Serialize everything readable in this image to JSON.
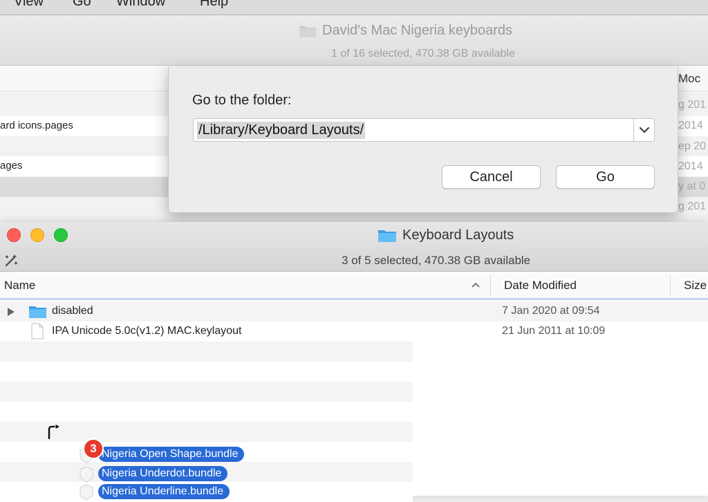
{
  "menubar": {
    "items": [
      "View",
      "Go",
      "Window",
      "Help"
    ]
  },
  "background_window": {
    "title": "David's Mac Nigeria keyboards",
    "status": "1 of 16 selected, 470.38 GB available",
    "column_right_header": "Moc",
    "rows": [
      "ard icons.pages",
      "ages"
    ],
    "right_column_values": [
      "g 201",
      "2014",
      "ep 20",
      "2014",
      "y at 0",
      "g 201"
    ]
  },
  "goto_sheet": {
    "label": "Go to the folder:",
    "path_value": "/Library/Keyboard Layouts/",
    "cancel_label": "Cancel",
    "go_label": "Go"
  },
  "front_window": {
    "title": "Keyboard Layouts",
    "status": "3 of 5 selected, 470.38 GB available",
    "columns": {
      "name": "Name",
      "date_modified": "Date Modified",
      "size": "Size"
    },
    "rows": [
      {
        "name": "disabled",
        "date": "7 Jan 2020 at 09:54",
        "kind": "folder"
      },
      {
        "name": "IPA Unicode 5.0c(v1.2) MAC.keylayout",
        "date": "21 Jun 2011 at 10:09",
        "kind": "file"
      }
    ]
  },
  "drag": {
    "count": "3",
    "items": [
      "Nigeria Open Shape.bundle",
      "Nigeria Underdot.bundle",
      "Nigeria Underline.bundle"
    ]
  },
  "colors": {
    "accent_selection": "#2869d5",
    "badge": "#e8392f",
    "folder": "#58b5f0"
  }
}
